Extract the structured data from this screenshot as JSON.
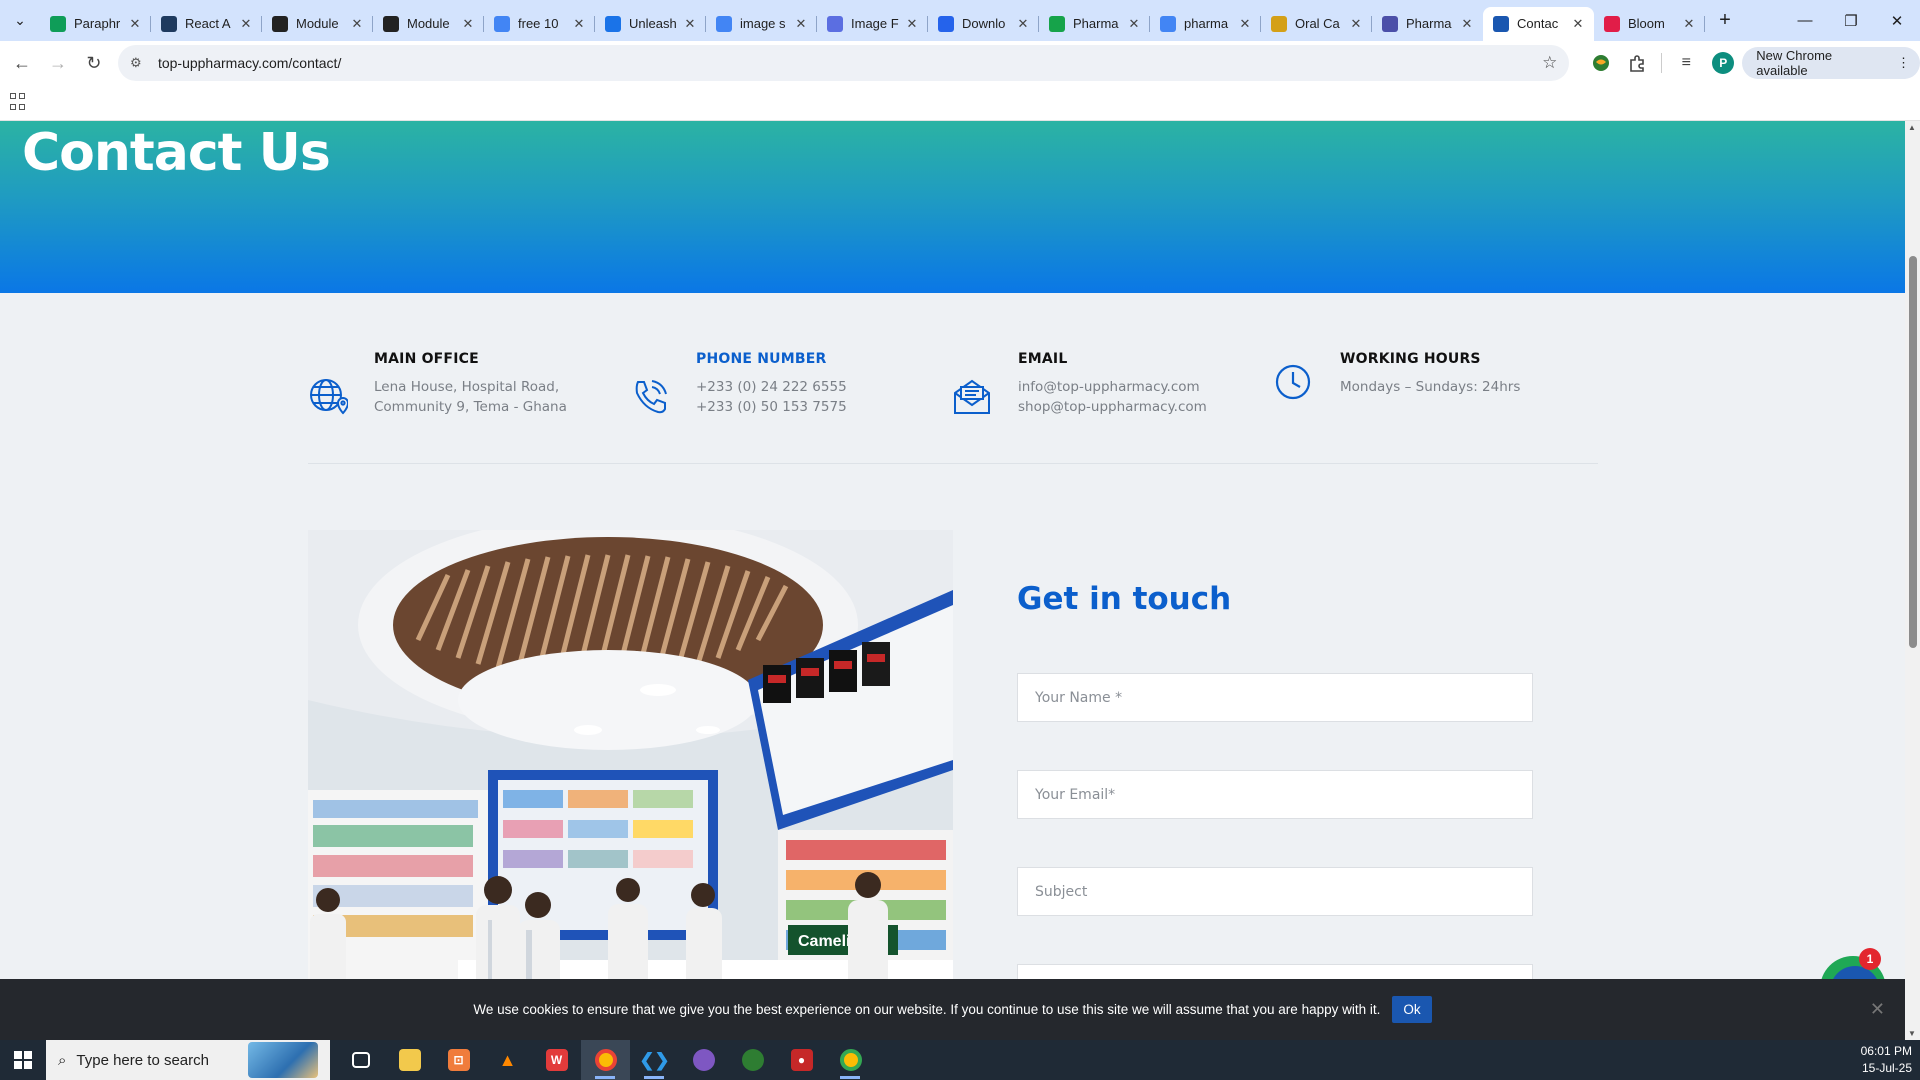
{
  "browser": {
    "tabs": [
      {
        "label": "Paraphr",
        "favicon": "sheets-icon",
        "color": "#0f9d58"
      },
      {
        "label": "React A",
        "favicon": "grid-icon",
        "color": "#1e3a5f"
      },
      {
        "label": "Module",
        "favicon": "circle-icon",
        "color": "#222222"
      },
      {
        "label": "Module",
        "favicon": "circle-icon",
        "color": "#222222"
      },
      {
        "label": "free 10",
        "favicon": "google-icon",
        "color": "#4285f4"
      },
      {
        "label": "Unleash",
        "favicon": "flag-icon",
        "color": "#1a73e8"
      },
      {
        "label": "image s",
        "favicon": "google-icon",
        "color": "#4285f4"
      },
      {
        "label": "Image F",
        "favicon": "zigzag-icon",
        "color": "#5b6ee1"
      },
      {
        "label": "Downlo",
        "favicon": "diamond-icon",
        "color": "#2563eb"
      },
      {
        "label": "Pharma",
        "favicon": "leaf-icon",
        "color": "#16a34a"
      },
      {
        "label": "pharma",
        "favicon": "google-icon",
        "color": "#4285f4"
      },
      {
        "label": "Oral Ca",
        "favicon": "grid-icon",
        "color": "#d4a017"
      },
      {
        "label": "Pharma",
        "favicon": "shield-icon",
        "color": "#4b4fa8"
      },
      {
        "label": "Contac",
        "favicon": "site-icon",
        "color": "#1a57b0",
        "active": true
      },
      {
        "label": "Bloom",
        "favicon": "asterisk-icon",
        "color": "#e11d48"
      }
    ],
    "url": "top-uppharmacy.com/contact/",
    "update_label": "New Chrome available",
    "profile_initial": "P"
  },
  "page": {
    "hero_title": "Contact Us",
    "info": [
      {
        "title": "MAIN OFFICE",
        "lines": [
          "Lena House, Hospital Road, Community 9, Tema - Ghana"
        ],
        "icon": "globe-icon",
        "highlight": false
      },
      {
        "title": "PHONE NUMBER",
        "lines": [
          "+233 (0) 24 222 6555",
          "+233 (0) 50 153 7575"
        ],
        "icon": "phone-icon",
        "highlight": true
      },
      {
        "title": "EMAIL",
        "lines": [
          "info@top-uppharmacy.com",
          "shop@top-uppharmacy.com"
        ],
        "icon": "mail-icon",
        "highlight": false
      },
      {
        "title": "WORKING HOURS",
        "lines": [
          "Mondays – Sundays: 24hrs"
        ],
        "icon": "clock-icon",
        "highlight": false
      }
    ],
    "form": {
      "heading": "Get in touch",
      "name_placeholder": "Your Name *",
      "email_placeholder": "Your Email*",
      "subject_placeholder": "Subject"
    },
    "cookie": {
      "text": "We use cookies to ensure that we give you the best experience on our website. If you continue to use this site we will assume that you are happy with it.",
      "ok_label": "Ok"
    },
    "chat_badge": "1",
    "accent_color": "#0b5fcc"
  },
  "taskbar": {
    "search_placeholder": "Type here to search",
    "time": "06:01 PM",
    "date": "15-Jul-25"
  }
}
